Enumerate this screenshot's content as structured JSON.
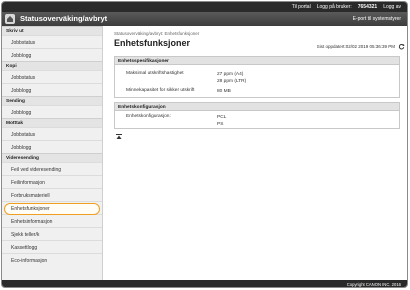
{
  "topbar": {
    "portal": "Til portal",
    "logout_user": "Logg på bruker:",
    "user_id": "7654321",
    "logout": "Logg av"
  },
  "header": {
    "title": "Statusoverväking/avbryt",
    "portal_link": "E-port til systemstyrer"
  },
  "sidebar": {
    "groups": [
      {
        "category": "Skriv ut",
        "items": [
          "Jobbstatus",
          "Jobblogg"
        ]
      },
      {
        "category": "Kopi",
        "items": [
          "Jobbstatus",
          "Jobblogg"
        ]
      },
      {
        "category": "Sending",
        "items": [
          "Jobblogg"
        ]
      },
      {
        "category": "Motttak",
        "items": [
          "Jobbstatus",
          "Jobblogg"
        ]
      },
      {
        "category": "Videresending",
        "items": [
          "Feil ved videresending"
        ]
      }
    ],
    "items_after": [
      "Feilinformasjon",
      "Forbruksmateriell",
      "Enhetsfunksjoner",
      "Enhetsinformasjon",
      "Sjekk teller/k",
      "Kassettlogg",
      "Eco-informasjon"
    ],
    "selected": "Enhetsfunksjoner"
  },
  "content": {
    "breadcrumb": "Statusoverväking/avbryt: Enhetsfunksjoner",
    "title": "Enhetsfunksjoner",
    "status": "Sist oppdatert:02/02 2019 05:36:39 PM",
    "sections": {
      "spec": {
        "title": "Enhetsspesifikasjoner",
        "rows": [
          {
            "key": "Maksimal utskriftshastighet",
            "value": [
              "27 ppm (A4)",
              "28 ppm (LTR)"
            ]
          },
          {
            "key": "Minnekapasitet for sikker utskrift",
            "value": [
              "80 MB"
            ]
          }
        ]
      },
      "config": {
        "title": "Enhetskonfigurasjon",
        "rows": [
          {
            "key": "Enhetskonfigurasjon:",
            "value": [
              "PCL",
              "PS"
            ]
          }
        ]
      }
    }
  },
  "footer": {
    "copyright": "Copyright CANON INC. 2016"
  },
  "colors": {
    "highlight": "#f0a020",
    "header": "#3c3c3c"
  }
}
